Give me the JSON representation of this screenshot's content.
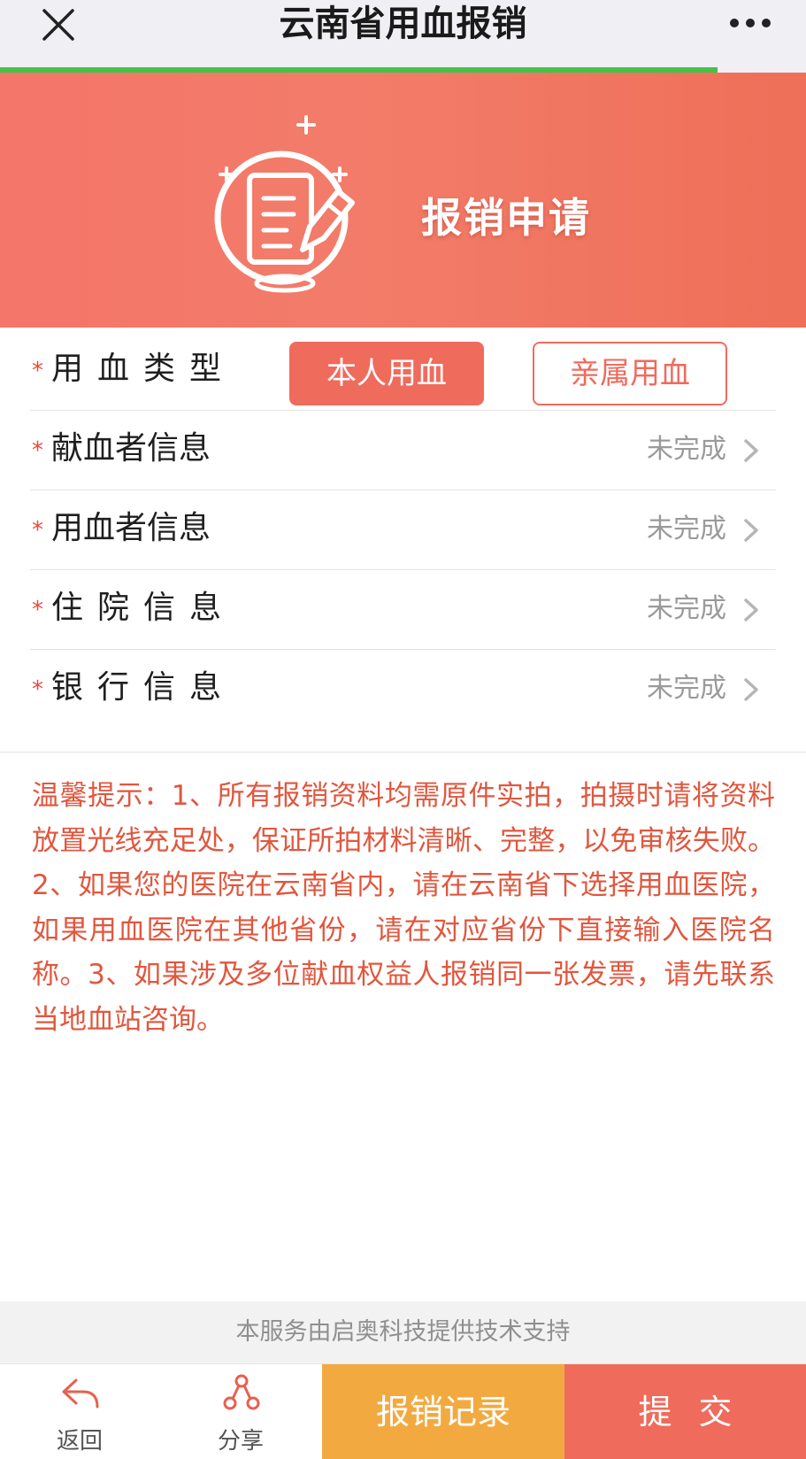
{
  "window": {
    "title": "云南省用血报销",
    "close_icon": "close-icon",
    "more_icon": "more-dots-icon",
    "load_progress_percent": 89
  },
  "banner": {
    "title": "报销申请",
    "icon": "document-edit-icon",
    "colors": {
      "start": "#f4756a",
      "end": "#ef6f58"
    }
  },
  "form": {
    "blood_type": {
      "required_mark": "*",
      "label": "用血类型",
      "options": [
        "本人用血",
        "亲属用血"
      ],
      "selected": "本人用血"
    },
    "rows": [
      {
        "required_mark": "*",
        "label": "献血者信息",
        "status": "未完成"
      },
      {
        "required_mark": "*",
        "label": "用血者信息",
        "status": "未完成"
      },
      {
        "required_mark": "*",
        "label": "住院信息",
        "status": "未完成"
      },
      {
        "required_mark": "*",
        "label": "银行信息",
        "status": "未完成"
      }
    ]
  },
  "tips": {
    "text": "温馨提示：1、所有报销资料均需原件实拍，拍摄时请将资料放置光线充足处，保证所拍材料清晰、完整，以免审核失败。2、如果您的医院在云南省内，请在云南省下选择用血医院，如果用血医院在其他省份，请在对应省份下直接输入医院名称。3、如果涉及多位献血权益人报销同一张发票，请先联系当地血站咨询。"
  },
  "footer": {
    "support_text": "本服务由启奥科技提供技术支持",
    "tabs": [
      {
        "label": "返回",
        "icon": "back-arrow-icon"
      },
      {
        "label": "分享",
        "icon": "share-icon"
      }
    ],
    "records_label": "报销记录",
    "submit_label": "提交"
  },
  "colors": {
    "accent": "#ef6b5c",
    "records": "#f2aa40",
    "progress": "#45c14a",
    "tips_text": "#e0573e"
  }
}
